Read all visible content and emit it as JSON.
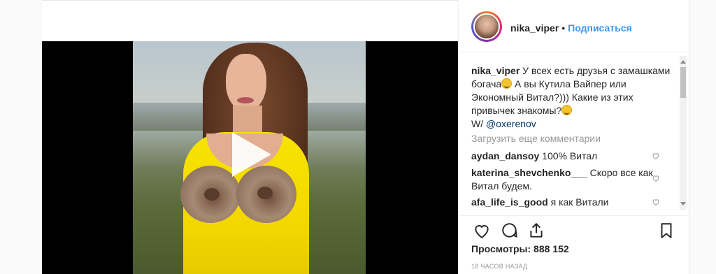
{
  "post": {
    "username": "nika_viper",
    "separator": "•",
    "follow_label": "Подписаться",
    "caption": {
      "username": "nika_viper",
      "text1": "У всех есть друзья с замашками богача",
      "text2": " А вы Кутила Вайпер или Экономный Витал?))) Какие из этих привычек знакомы?",
      "line_prefix": "W/ ",
      "mention": "@oxerenov"
    },
    "load_more": "Загрузить еще комментарии",
    "comments": [
      {
        "user": "aydan_dansoy",
        "text": "100% Витал"
      },
      {
        "user": "katerina_shevchenko___",
        "text": "Скоро все как Витал будем."
      },
      {
        "user": "afa_life_is_good",
        "text": "я как Витали"
      }
    ],
    "views_label": "Просмотры: 888 152",
    "time_ago": "18 ЧАСОВ НАЗАД"
  },
  "icons": [
    "heart-icon",
    "comment-icon",
    "share-icon",
    "bookmark-icon",
    "play-icon"
  ],
  "colors": {
    "accent": "#3897f0",
    "text": "#262626",
    "muted": "#999999",
    "mention": "#003569"
  }
}
